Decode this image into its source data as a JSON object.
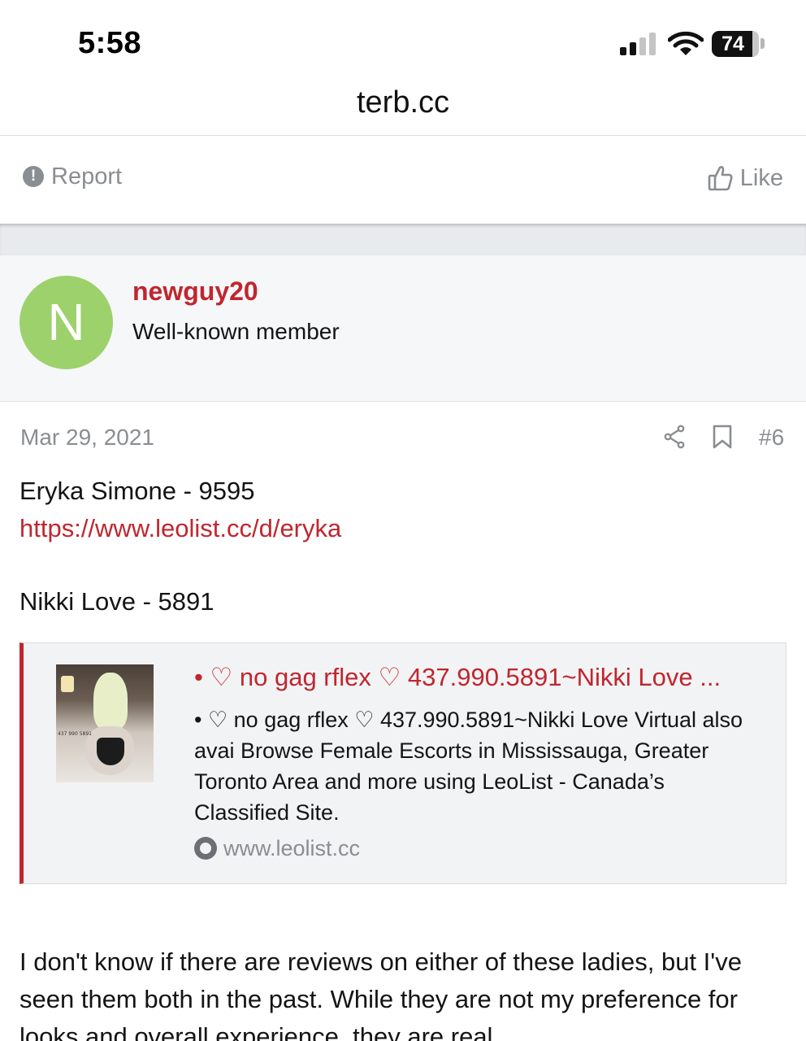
{
  "status_bar": {
    "time": "5:58",
    "battery": "74",
    "icons": [
      "signal-icon",
      "wifi-icon",
      "battery-icon"
    ]
  },
  "browser": {
    "url": "terb.cc"
  },
  "actions": {
    "report_label": "Report",
    "like_label": "Like"
  },
  "user": {
    "avatar_letter": "N",
    "avatar_color": "#9dd16c",
    "username": "newguy20",
    "title": "Well-known member"
  },
  "post": {
    "date": "Mar 29, 2021",
    "number": "#6",
    "line1": "Eryka Simone - 9595",
    "link1": "https://www.leolist.cc/d/eryka",
    "line2": "Nikki Love - 5891",
    "embed": {
      "title": "• ♡ no gag rflex ♡ 437.990.5891~Nikki Love ...",
      "description": "• ♡ no gag rflex ♡ 437.990.5891~Nikki Love Virtual also avai Browse Female Escorts in Mississauga, Greater Toronto Area and more using LeoList - Canada’s Classified Site.",
      "domain": "www.leolist.cc",
      "thumb_tag": "437 990 5891"
    },
    "paragraph": "I don't know if there are reviews on either of these ladies, but I've seen them both in the past. While they are not my preference for looks and overall experience, they are real"
  },
  "colors": {
    "accent": "#c0262f",
    "muted": "#8a8d91",
    "band": "#e8ebee"
  }
}
